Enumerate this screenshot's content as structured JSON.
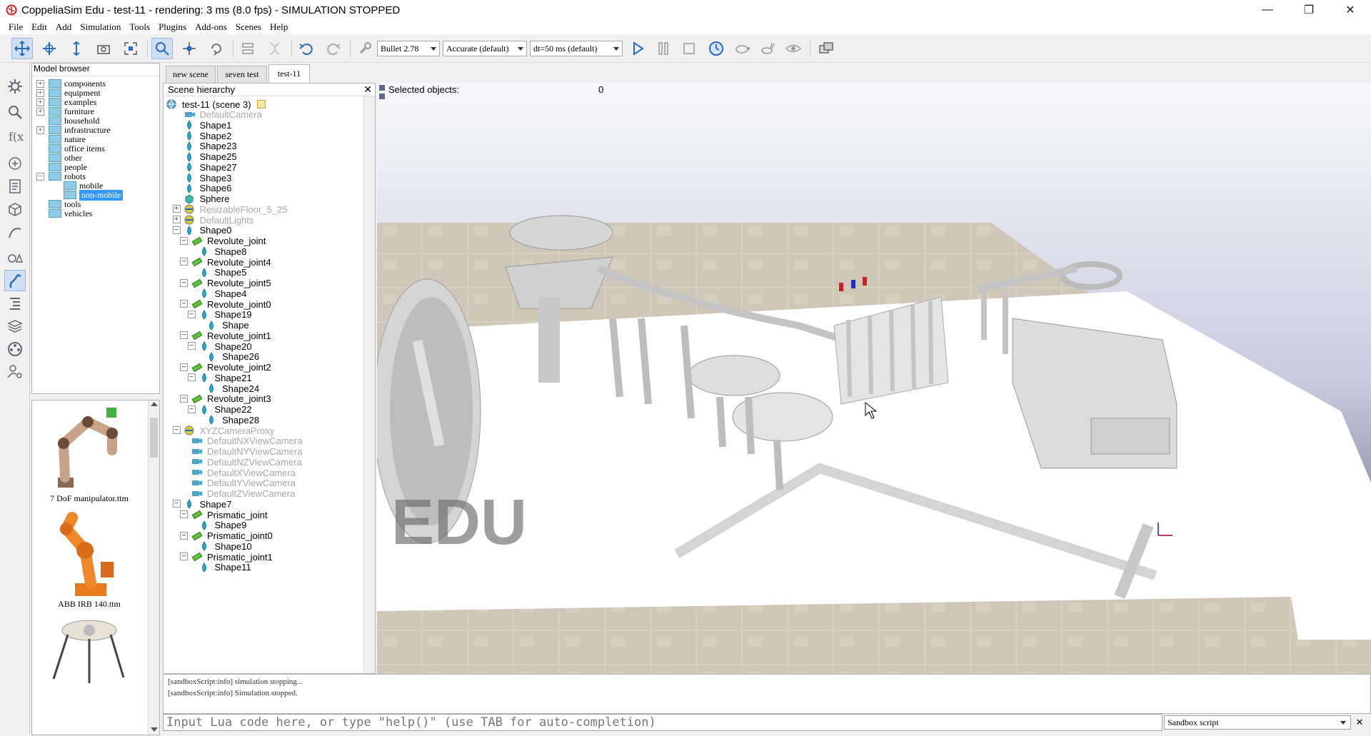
{
  "window": {
    "title": "CoppeliaSim Edu - test-11 - rendering: 3 ms (8.0 fps) - SIMULATION STOPPED",
    "minimize": "—",
    "restore": "❐",
    "close": "✕"
  },
  "menu": [
    "File",
    "Edit",
    "Add",
    "Simulation",
    "Tools",
    "Plugins",
    "Add-ons",
    "Scenes",
    "Help"
  ],
  "toolbar": {
    "engine": "Bullet 2.78",
    "accuracy": "Accurate (default)",
    "timestep": "dt=50 ms (default)"
  },
  "model_browser": {
    "header": "Model browser",
    "items": [
      {
        "label": "components",
        "expandable": true,
        "level": 0
      },
      {
        "label": "equipment",
        "expandable": true,
        "level": 0
      },
      {
        "label": "examples",
        "expandable": true,
        "level": 0
      },
      {
        "label": "furniture",
        "expandable": true,
        "level": 0
      },
      {
        "label": "household",
        "expandable": false,
        "level": 0
      },
      {
        "label": "infrastructure",
        "expandable": true,
        "level": 0
      },
      {
        "label": "nature",
        "expandable": false,
        "level": 0
      },
      {
        "label": "office items",
        "expandable": false,
        "level": 0
      },
      {
        "label": "other",
        "expandable": false,
        "level": 0
      },
      {
        "label": "people",
        "expandable": false,
        "level": 0
      },
      {
        "label": "robots",
        "expandable": true,
        "expanded": true,
        "level": 0
      },
      {
        "label": "mobile",
        "expandable": false,
        "level": 1
      },
      {
        "label": "non-mobile",
        "expandable": false,
        "level": 1,
        "selected": true
      },
      {
        "label": "tools",
        "expandable": false,
        "level": 0
      },
      {
        "label": "vehicles",
        "expandable": false,
        "level": 0
      }
    ]
  },
  "thumbnails": [
    {
      "label": "7 DoF manipulator.ttm"
    },
    {
      "label": "ABB IRB 140.ttm"
    }
  ],
  "tabs": [
    {
      "label": "new scene",
      "active": false
    },
    {
      "label": "seven test",
      "active": false
    },
    {
      "label": "test-11",
      "active": true
    }
  ],
  "hierarchy": {
    "header": "Scene hierarchy",
    "root": "test-11 (scene 3)",
    "items": [
      {
        "label": "DefaultCamera",
        "level": 1,
        "type": "camera",
        "dim": true
      },
      {
        "label": "Shape1",
        "level": 1,
        "type": "shape"
      },
      {
        "label": "Shape2",
        "level": 1,
        "type": "shape"
      },
      {
        "label": "Shape23",
        "level": 1,
        "type": "shape"
      },
      {
        "label": "Shape25",
        "level": 1,
        "type": "shape"
      },
      {
        "label": "Shape27",
        "level": 1,
        "type": "shape"
      },
      {
        "label": "Shape3",
        "level": 1,
        "type": "shape"
      },
      {
        "label": "Shape6",
        "level": 1,
        "type": "shape"
      },
      {
        "label": "Sphere",
        "level": 1,
        "type": "cube"
      },
      {
        "label": "ResizableFloor_5_25",
        "level": 1,
        "type": "model",
        "dim": true,
        "expander": "+"
      },
      {
        "label": "DefaultLights",
        "level": 1,
        "type": "model",
        "dim": true,
        "expander": "+"
      },
      {
        "label": "Shape0",
        "level": 1,
        "type": "shape",
        "expander": "-"
      },
      {
        "label": "Revolute_joint",
        "level": 2,
        "type": "joint",
        "expander": "-"
      },
      {
        "label": "Shape8",
        "level": 3,
        "type": "shape"
      },
      {
        "label": "Revolute_joint4",
        "level": 2,
        "type": "joint",
        "expander": "-"
      },
      {
        "label": "Shape5",
        "level": 3,
        "type": "shape"
      },
      {
        "label": "Revolute_joint5",
        "level": 2,
        "type": "joint",
        "expander": "-"
      },
      {
        "label": "Shape4",
        "level": 3,
        "type": "shape"
      },
      {
        "label": "Revolute_joint0",
        "level": 2,
        "type": "joint",
        "expander": "-"
      },
      {
        "label": "Shape19",
        "level": 3,
        "type": "shape",
        "expander": "-"
      },
      {
        "label": "Shape",
        "level": 4,
        "type": "shape"
      },
      {
        "label": "Revolute_joint1",
        "level": 2,
        "type": "joint",
        "expander": "-"
      },
      {
        "label": "Shape20",
        "level": 3,
        "type": "shape",
        "expander": "-"
      },
      {
        "label": "Shape26",
        "level": 4,
        "type": "shape"
      },
      {
        "label": "Revolute_joint2",
        "level": 2,
        "type": "joint",
        "expander": "-"
      },
      {
        "label": "Shape21",
        "level": 3,
        "type": "shape",
        "expander": "-"
      },
      {
        "label": "Shape24",
        "level": 4,
        "type": "shape"
      },
      {
        "label": "Revolute_joint3",
        "level": 2,
        "type": "joint",
        "expander": "-"
      },
      {
        "label": "Shape22",
        "level": 3,
        "type": "shape",
        "expander": "-"
      },
      {
        "label": "Shape28",
        "level": 4,
        "type": "shape"
      },
      {
        "label": "XYZCameraProxy",
        "level": 1,
        "type": "model",
        "dim": true,
        "expander": "-"
      },
      {
        "label": "DefaultNXViewCamera",
        "level": 2,
        "type": "camera",
        "dim": true
      },
      {
        "label": "DefaultNYViewCamera",
        "level": 2,
        "type": "camera",
        "dim": true
      },
      {
        "label": "DefaultNZViewCamera",
        "level": 2,
        "type": "camera",
        "dim": true
      },
      {
        "label": "DefaultXViewCamera",
        "level": 2,
        "type": "camera",
        "dim": true
      },
      {
        "label": "DefaultYViewCamera",
        "level": 2,
        "type": "camera",
        "dim": true
      },
      {
        "label": "DefaultZViewCamera",
        "level": 2,
        "type": "camera",
        "dim": true
      },
      {
        "label": "Shape7",
        "level": 1,
        "type": "shape",
        "expander": "-"
      },
      {
        "label": "Prismatic_joint",
        "level": 2,
        "type": "joint",
        "expander": "-"
      },
      {
        "label": "Shape9",
        "level": 3,
        "type": "shape"
      },
      {
        "label": "Prismatic_joint0",
        "level": 2,
        "type": "joint",
        "expander": "-"
      },
      {
        "label": "Shape10",
        "level": 3,
        "type": "shape"
      },
      {
        "label": "Prismatic_joint1",
        "level": 2,
        "type": "joint",
        "expander": "-"
      },
      {
        "label": "Shape11",
        "level": 3,
        "type": "shape"
      }
    ]
  },
  "viewport": {
    "selected_label": "Selected objects:",
    "selected_count": "0",
    "watermark": "EDU"
  },
  "console": {
    "lines": [
      "[sandboxScript:info] simulation stopping...",
      "[sandboxScript:info] Simulation stopped."
    ],
    "input_placeholder": "Input Lua code here, or type \"help()\" (use TAB for auto-completion)",
    "script_selector": "Sandbox script",
    "close": "✕"
  },
  "colors": {
    "accent": "#3399ff",
    "joint": "#4fb233",
    "shape": "#28a8d0",
    "folder": "#8fcbe4"
  }
}
